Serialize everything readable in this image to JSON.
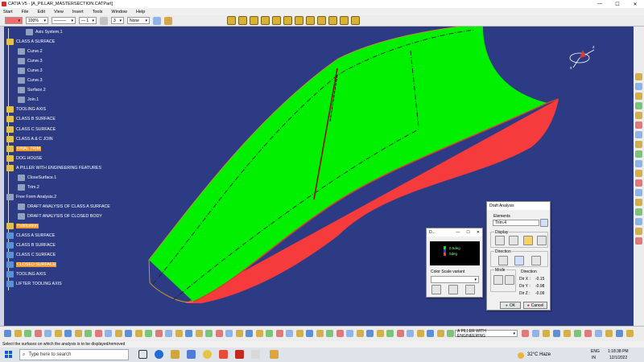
{
  "window": {
    "title": "CATIA V5 - [A_PILLAR_MASTERSECTION.CATPart]",
    "min": "—",
    "max": "☐",
    "close": "✕"
  },
  "menu": [
    "Start",
    "File",
    "Edit",
    "View",
    "Insert",
    "Tools",
    "Window",
    "Help"
  ],
  "toolbar": {
    "zoom": "100%",
    "line_weight": "1",
    "layer_num": "3",
    "layer": "None"
  },
  "tree": [
    {
      "label": "Axis System.1",
      "icon": "axis-icon",
      "color": "#8fa0c0"
    },
    {
      "label": "CLASS A SURFACE",
      "icon": "geoset-icon",
      "color": "#e2c14a"
    },
    {
      "label": "Curve.2",
      "icon": "curve-icon",
      "color": "#8fa0c0"
    },
    {
      "label": "Curve.3",
      "icon": "curve-icon",
      "color": "#8fa0c0"
    },
    {
      "label": "Curve.3",
      "icon": "curve-icon",
      "color": "#8fa0c0"
    },
    {
      "label": "Curve.3",
      "icon": "curve-icon",
      "color": "#8fa0c0"
    },
    {
      "label": "Surface.2",
      "icon": "surface-icon",
      "color": "#8fa0c0"
    },
    {
      "label": "Join.1",
      "icon": "join-icon",
      "color": "#8fa0c0"
    },
    {
      "label": "TOOLING AXIS",
      "icon": "geoset-icon",
      "color": "#e2c14a"
    },
    {
      "label": "CLASS B SURFACE",
      "icon": "geoset-icon",
      "color": "#e2c14a"
    },
    {
      "label": "CLASS C SURFACE",
      "icon": "geoset-icon",
      "color": "#e2c14a"
    },
    {
      "label": "CLASS A & C JOIN",
      "icon": "geoset-icon",
      "color": "#e2c14a"
    },
    {
      "label": "FINAL TRIM",
      "icon": "geoset-icon",
      "color": "#e2c14a",
      "highlight": true
    },
    {
      "label": "DOG HOUSE",
      "icon": "geoset-icon",
      "color": "#e2c14a"
    },
    {
      "label": "A PILLER WITH ENGINEERING FEATURES",
      "icon": "geoset-icon",
      "color": "#e2c14a"
    },
    {
      "label": "CloseSurface.1",
      "icon": "surface-icon",
      "color": "#8fa0c0"
    },
    {
      "label": "Trim.2",
      "icon": "trim-icon",
      "color": "#8fa0c0"
    },
    {
      "label": "Free Form Analysis.2",
      "icon": "analysis-icon",
      "color": "#8fa0c0"
    },
    {
      "label": "DRAFT ANALYSIS OF CLASS A SURFACE",
      "icon": "draft-icon",
      "color": "#8fa0c0"
    },
    {
      "label": "DRAFT ANALYSIS OF CLOSED BODY",
      "icon": "draft-icon",
      "color": "#8fa0c0"
    },
    {
      "label": "Publication",
      "icon": "publication-icon",
      "color": "#e2c14a",
      "highlight": true
    },
    {
      "label": "CLASS A SURFACE",
      "icon": "publication-icon",
      "color": "#5b8fd6"
    },
    {
      "label": "CLASS B SURFACE",
      "icon": "publication-icon",
      "color": "#5b8fd6"
    },
    {
      "label": "CLASS C SURFACE",
      "icon": "publication-icon",
      "color": "#5b8fd6"
    },
    {
      "label": "CLOSED SURFACE",
      "icon": "publication-icon",
      "color": "#5b8fd6",
      "highlight": true
    },
    {
      "label": "TOOLING AXIS",
      "icon": "publication-icon",
      "color": "#5b8fd6"
    },
    {
      "label": "LIFTER TOOLING AXIS",
      "icon": "publication-icon",
      "color": "#5b8fd6"
    }
  ],
  "scale_dialog": {
    "title": "D...",
    "legend": [
      "0.5deg",
      "0deg"
    ],
    "variant_label": "Color Scale variant"
  },
  "draft_dialog": {
    "title": "Draft Analysis",
    "elements_label": "Elements",
    "elements_value": "Trim.4",
    "display_label": "Display",
    "direction_label": "Direction",
    "mode_label": "Mode",
    "dir_label": "Direction",
    "dir_x": "Dir X :",
    "dir_x_val": "-0.15",
    "dir_y": "Dir Y :",
    "dir_y_val": "-0.98",
    "dir_z": "Dir Z :",
    "dir_z_val": "-0.09",
    "ok": "OK",
    "cancel": "Cancel"
  },
  "bottom": {
    "combo": "A PILLER WITH ENGINEERING"
  },
  "status": "Select the surfaces on which the analysis is to be displayed/removed",
  "taskbar": {
    "search": "Type here to search",
    "weather": "32°C  Haze",
    "lang1": "ENG",
    "lang2": "IN",
    "time": "1:18:38 PM",
    "date": "12/1/2022"
  },
  "colors": {
    "surface_green": "#00f000",
    "surface_red": "#f53b3b",
    "background": "#2d3a84"
  }
}
